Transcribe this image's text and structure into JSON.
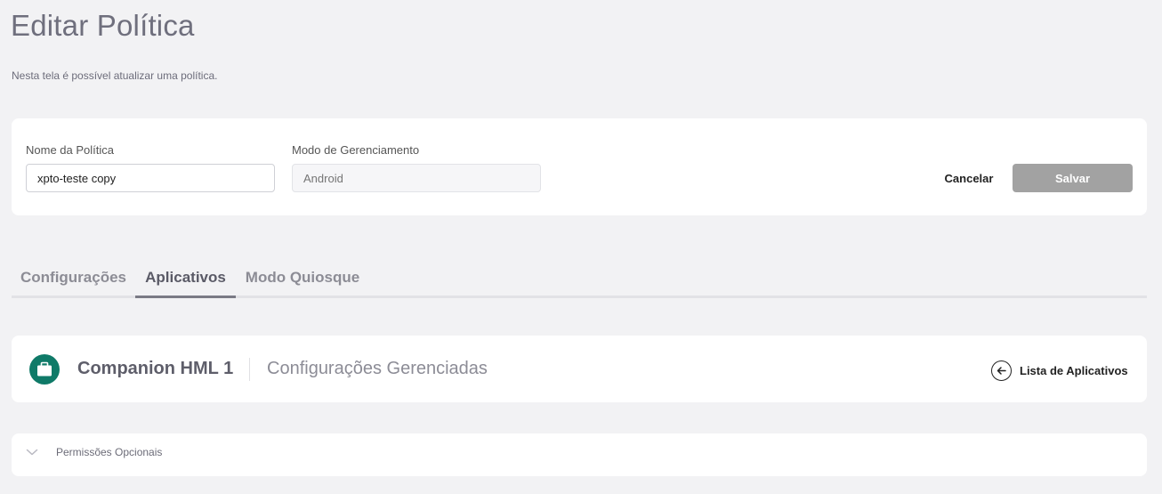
{
  "header": {
    "title": "Editar Política",
    "subtitle": "Nesta tela é possível atualizar uma política."
  },
  "form": {
    "policy_name_label": "Nome da Política",
    "policy_name_value": "xpto-teste copy",
    "management_mode_label": "Modo de Gerenciamento",
    "management_mode_placeholder": "Android",
    "cancel_label": "Cancelar",
    "save_label": "Salvar"
  },
  "tabs": [
    {
      "label": "Configurações",
      "active": false
    },
    {
      "label": "Aplicativos",
      "active": true
    },
    {
      "label": "Modo Quiosque",
      "active": false
    }
  ],
  "app": {
    "name": "Companion HML 1",
    "section": "Configurações Gerenciadas",
    "back_link_label": "Lista de Aplicativos",
    "icon": "briefcase-icon",
    "icon_color": "#0f7a68"
  },
  "permissions": {
    "label": "Permissões Opcionais",
    "icon": "chevron-down-icon"
  },
  "colors": {
    "background": "#f2f2f4",
    "save_button": "#a2a2a2",
    "active_tab": "#5a5a66"
  }
}
